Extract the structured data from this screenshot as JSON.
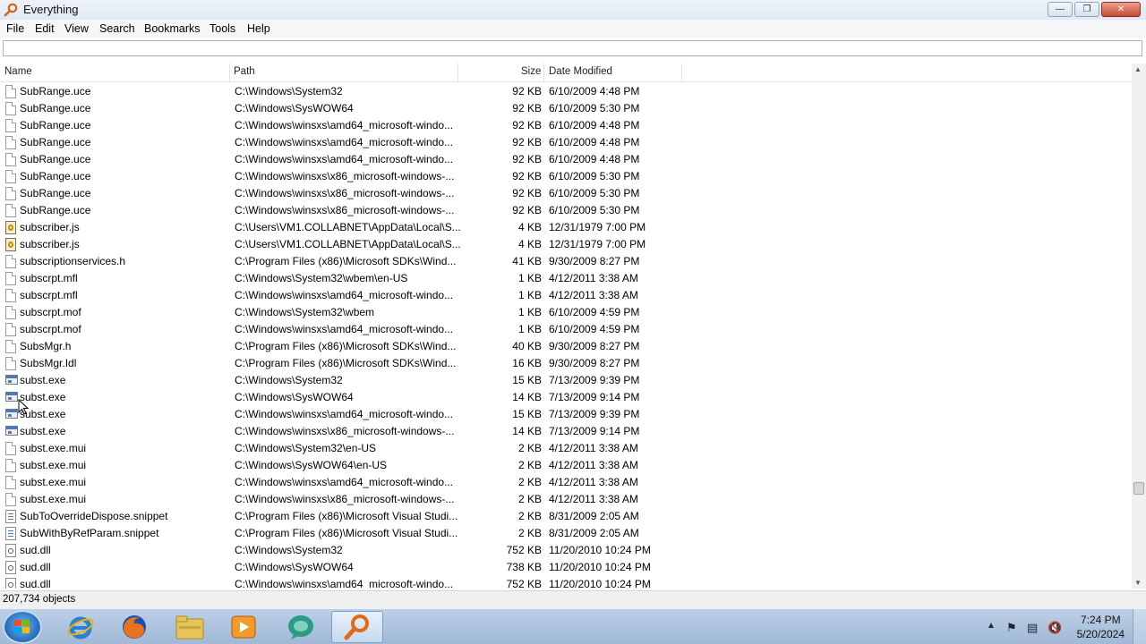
{
  "window": {
    "title": "Everything"
  },
  "menu": [
    "File",
    "Edit",
    "View",
    "Search",
    "Bookmarks",
    "Tools",
    "Help"
  ],
  "search": {
    "value": "",
    "placeholder": ""
  },
  "columns": {
    "name": "Name",
    "path": "Path",
    "size": "Size",
    "date": "Date Modified"
  },
  "rows": [
    {
      "icon": "document-icon",
      "name": "SubRange.uce",
      "path": "C:\\Windows\\System32",
      "size": "92 KB",
      "date": "6/10/2009 4:48 PM"
    },
    {
      "icon": "document-icon",
      "name": "SubRange.uce",
      "path": "C:\\Windows\\SysWOW64",
      "size": "92 KB",
      "date": "6/10/2009 5:30 PM"
    },
    {
      "icon": "document-icon",
      "name": "SubRange.uce",
      "path": "C:\\Windows\\winsxs\\amd64_microsoft-windo...",
      "size": "92 KB",
      "date": "6/10/2009 4:48 PM"
    },
    {
      "icon": "document-icon",
      "name": "SubRange.uce",
      "path": "C:\\Windows\\winsxs\\amd64_microsoft-windo...",
      "size": "92 KB",
      "date": "6/10/2009 4:48 PM"
    },
    {
      "icon": "document-icon",
      "name": "SubRange.uce",
      "path": "C:\\Windows\\winsxs\\amd64_microsoft-windo...",
      "size": "92 KB",
      "date": "6/10/2009 4:48 PM"
    },
    {
      "icon": "document-icon",
      "name": "SubRange.uce",
      "path": "C:\\Windows\\winsxs\\x86_microsoft-windows-...",
      "size": "92 KB",
      "date": "6/10/2009 5:30 PM"
    },
    {
      "icon": "document-icon",
      "name": "SubRange.uce",
      "path": "C:\\Windows\\winsxs\\x86_microsoft-windows-...",
      "size": "92 KB",
      "date": "6/10/2009 5:30 PM"
    },
    {
      "icon": "document-icon",
      "name": "SubRange.uce",
      "path": "C:\\Windows\\winsxs\\x86_microsoft-windows-...",
      "size": "92 KB",
      "date": "6/10/2009 5:30 PM"
    },
    {
      "icon": "script-icon",
      "name": "subscriber.js",
      "path": "C:\\Users\\VM1.COLLABNET\\AppData\\Local\\S...",
      "size": "4 KB",
      "date": "12/31/1979 7:00 PM"
    },
    {
      "icon": "script-icon",
      "name": "subscriber.js",
      "path": "C:\\Users\\VM1.COLLABNET\\AppData\\Local\\S...",
      "size": "4 KB",
      "date": "12/31/1979 7:00 PM"
    },
    {
      "icon": "document-icon",
      "name": "subscriptionservices.h",
      "path": "C:\\Program Files (x86)\\Microsoft SDKs\\Wind...",
      "size": "41 KB",
      "date": "9/30/2009 8:27 PM"
    },
    {
      "icon": "document-icon",
      "name": "subscrpt.mfl",
      "path": "C:\\Windows\\System32\\wbem\\en-US",
      "size": "1 KB",
      "date": "4/12/2011 3:38 AM"
    },
    {
      "icon": "document-icon",
      "name": "subscrpt.mfl",
      "path": "C:\\Windows\\winsxs\\amd64_microsoft-windo...",
      "size": "1 KB",
      "date": "4/12/2011 3:38 AM"
    },
    {
      "icon": "document-icon",
      "name": "subscrpt.mof",
      "path": "C:\\Windows\\System32\\wbem",
      "size": "1 KB",
      "date": "6/10/2009 4:59 PM"
    },
    {
      "icon": "document-icon",
      "name": "subscrpt.mof",
      "path": "C:\\Windows\\winsxs\\amd64_microsoft-windo...",
      "size": "1 KB",
      "date": "6/10/2009 4:59 PM"
    },
    {
      "icon": "document-icon",
      "name": "SubsMgr.h",
      "path": "C:\\Program Files (x86)\\Microsoft SDKs\\Wind...",
      "size": "40 KB",
      "date": "9/30/2009 8:27 PM"
    },
    {
      "icon": "document-icon",
      "name": "SubsMgr.Idl",
      "path": "C:\\Program Files (x86)\\Microsoft SDKs\\Wind...",
      "size": "16 KB",
      "date": "9/30/2009 8:27 PM"
    },
    {
      "icon": "executable-icon",
      "name": "subst.exe",
      "path": "C:\\Windows\\System32",
      "size": "15 KB",
      "date": "7/13/2009 9:39 PM"
    },
    {
      "icon": "executable-icon",
      "name": "subst.exe",
      "path": "C:\\Windows\\SysWOW64",
      "size": "14 KB",
      "date": "7/13/2009 9:14 PM"
    },
    {
      "icon": "executable-icon",
      "name": "subst.exe",
      "path": "C:\\Windows\\winsxs\\amd64_microsoft-windo...",
      "size": "15 KB",
      "date": "7/13/2009 9:39 PM"
    },
    {
      "icon": "executable-icon",
      "name": "subst.exe",
      "path": "C:\\Windows\\winsxs\\x86_microsoft-windows-...",
      "size": "14 KB",
      "date": "7/13/2009 9:14 PM"
    },
    {
      "icon": "document-icon",
      "name": "subst.exe.mui",
      "path": "C:\\Windows\\System32\\en-US",
      "size": "2 KB",
      "date": "4/12/2011 3:38 AM"
    },
    {
      "icon": "document-icon",
      "name": "subst.exe.mui",
      "path": "C:\\Windows\\SysWOW64\\en-US",
      "size": "2 KB",
      "date": "4/12/2011 3:38 AM"
    },
    {
      "icon": "document-icon",
      "name": "subst.exe.mui",
      "path": "C:\\Windows\\winsxs\\amd64_microsoft-windo...",
      "size": "2 KB",
      "date": "4/12/2011 3:38 AM"
    },
    {
      "icon": "document-icon",
      "name": "subst.exe.mui",
      "path": "C:\\Windows\\winsxs\\x86_microsoft-windows-...",
      "size": "2 KB",
      "date": "4/12/2011 3:38 AM"
    },
    {
      "icon": "snippet-icon",
      "name": "SubToOverrideDispose.snippet",
      "path": "C:\\Program Files (x86)\\Microsoft Visual Studi...",
      "size": "2 KB",
      "date": "8/31/2009 2:05 AM"
    },
    {
      "icon": "snippet-icon",
      "name": "SubWithByRefParam.snippet",
      "path": "C:\\Program Files (x86)\\Microsoft Visual Studi...",
      "size": "2 KB",
      "date": "8/31/2009 2:05 AM"
    },
    {
      "icon": "dll-icon",
      "name": "sud.dll",
      "path": "C:\\Windows\\System32",
      "size": "752 KB",
      "date": "11/20/2010 10:24 PM"
    },
    {
      "icon": "dll-icon",
      "name": "sud.dll",
      "path": "C:\\Windows\\SysWOW64",
      "size": "738 KB",
      "date": "11/20/2010 10:24 PM"
    },
    {
      "icon": "dll-icon",
      "name": "sud.dll",
      "path": "C:\\Windows\\winsxs\\amd64_microsoft-windo...",
      "size": "752 KB",
      "date": "11/20/2010 10:24 PM"
    }
  ],
  "status": {
    "text": "207,734 objects"
  },
  "taskbar": {
    "apps": [
      "internet-explorer-icon",
      "firefox-icon",
      "file-explorer-icon",
      "media-player-icon",
      "chat-app-icon",
      "everything-search-icon"
    ],
    "clock_time": "7:24 PM",
    "clock_date": "5/20/2024"
  },
  "colors": {
    "taskbar": "#a9c1dc",
    "close_button": "#c84a33",
    "titlebar": "#e6eef8"
  }
}
